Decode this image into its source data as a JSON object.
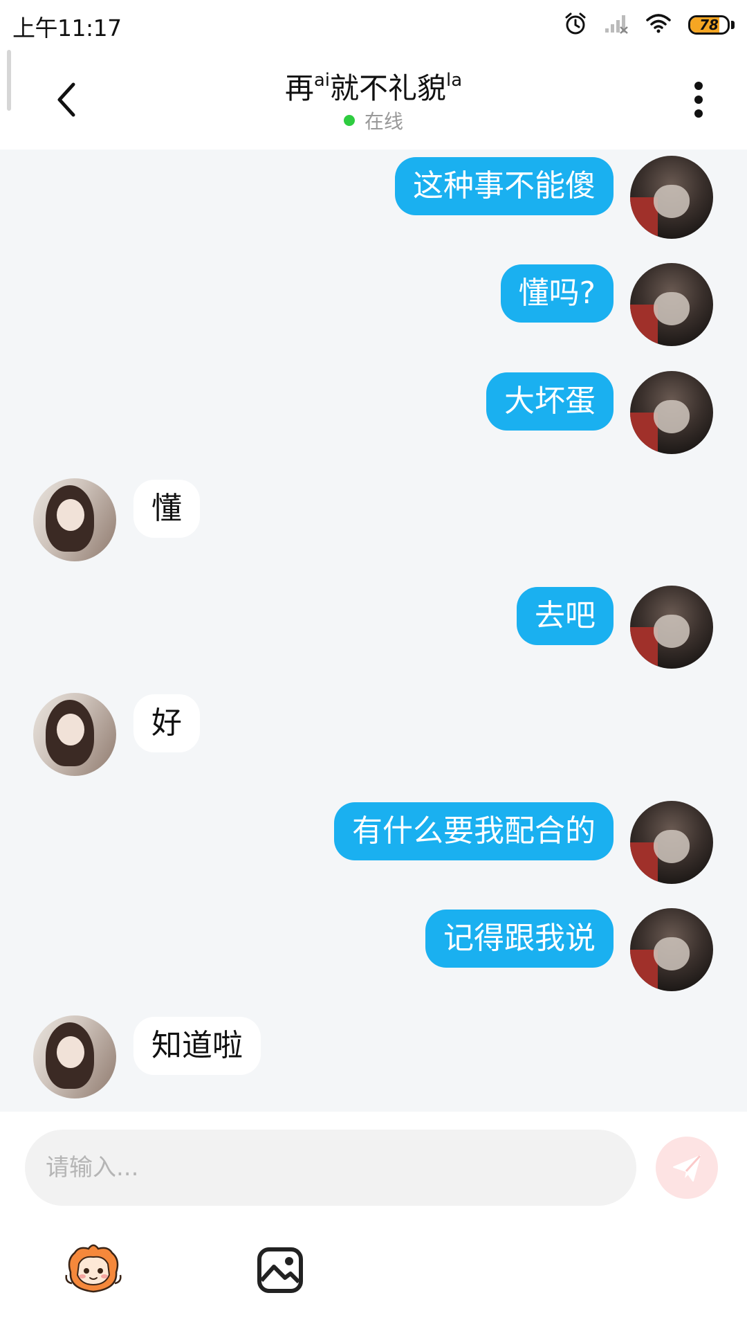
{
  "status_bar": {
    "time": "上午11:17",
    "battery_level": "78",
    "icons": [
      "alarm-icon",
      "signal-icon",
      "wifi-icon",
      "battery-icon"
    ]
  },
  "header": {
    "title_main": "再",
    "title_sup1": "ai",
    "title_mid": "就不礼貌",
    "title_sup2": "la",
    "status_text": "在线",
    "status_color": "#2ecc40",
    "icons": [
      "back-arrow-icon",
      "more-vertical-icon"
    ]
  },
  "messages": [
    {
      "side": "right",
      "text": "这种事不能傻"
    },
    {
      "side": "right",
      "text": "懂吗?"
    },
    {
      "side": "right",
      "text": "大坏蛋"
    },
    {
      "side": "left",
      "text": "懂"
    },
    {
      "side": "right",
      "text": "去吧"
    },
    {
      "side": "left",
      "text": "好"
    },
    {
      "side": "right",
      "text": "有什么要我配合的"
    },
    {
      "side": "right",
      "text": "记得跟我说"
    },
    {
      "side": "left",
      "text": "知道啦"
    }
  ],
  "input": {
    "placeholder": "请输入..."
  },
  "colors": {
    "sent_bubble": "#1ab0f0",
    "received_bubble": "#ffffff",
    "chat_background": "#f4f6f8",
    "send_button": "#fde3e3"
  },
  "toolbar": {
    "icons": [
      "mascot-emoji-icon",
      "image-icon"
    ]
  }
}
